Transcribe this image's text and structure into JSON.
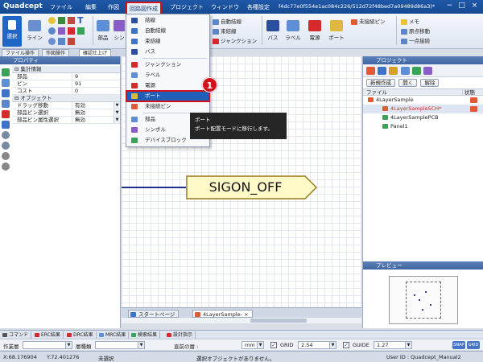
{
  "app": {
    "logo": "Quadcept",
    "menus": [
      "ファイル",
      "編集",
      "作図",
      "回路図作成",
      "プロジェクト",
      "ウィンドウ",
      "各種設定"
    ],
    "active_menu_index": 3,
    "file_path": "f4dc77e0f554e1ac084c226/512d72f48bed7a09489d86a3)*",
    "window_controls": [
      "−",
      "□",
      "×"
    ]
  },
  "ribbon": {
    "select_label": "選択",
    "line_label": "ライン",
    "parts_label": "部品",
    "sym_label": "シン",
    "right_small": [
      "自動結線",
      "束結線",
      "ジャンクション"
    ],
    "bus_label": "バス",
    "label_label": "ラベル",
    "power_label": "電源",
    "port_label": "ポート",
    "unconnected_pin": "未接続ピン",
    "memo": "メモ",
    "origin_move": "原点移動",
    "one_point": "一点接続"
  },
  "tabs_left": [
    "ファイル操作",
    "作図操作",
    "確認仕上げ"
  ],
  "property_panel": {
    "title": "プロパティ",
    "sections": [
      {
        "name": "集計情報",
        "rows": [
          {
            "key": "部品",
            "value": "9"
          },
          {
            "key": "ピン",
            "value": "91"
          },
          {
            "key": "コスト",
            "value": "0"
          }
        ]
      },
      {
        "name": "オブジェクト",
        "rows": [
          {
            "key": "ドラッグ移動",
            "value": "有効"
          },
          {
            "key": "部品ピン選択",
            "value": "無効"
          },
          {
            "key": "部品ピン属性選択",
            "value": "無効"
          }
        ]
      }
    ]
  },
  "dropdown": {
    "items": [
      {
        "label": "結線",
        "color": "#2c4ea0"
      },
      {
        "label": "自動結線",
        "color": "#3b73c6"
      },
      {
        "label": "束結線",
        "color": "#3b73c6"
      },
      {
        "label": "バス",
        "color": "#2c4ea0"
      },
      {
        "label": "ジャンクション",
        "color": "#d6292c"
      },
      {
        "label": "ラベル",
        "color": "#5e8fd6"
      },
      {
        "label": "電源",
        "color": "#d6292c"
      },
      {
        "label": "ポート",
        "color": "#e0b740"
      },
      {
        "label": "未接続ピン",
        "color": "#e05a38"
      },
      {
        "label": "部品",
        "color": "#5e8fd6"
      },
      {
        "label": "シンボル",
        "color": "#8a5cc7"
      },
      {
        "label": "デバイスブロック",
        "color": "#3aa35a"
      }
    ],
    "selected_index": 7
  },
  "callout": "1",
  "tooltip": {
    "title": "ポート",
    "text": "ポート配置モードに移行します。"
  },
  "canvas": {
    "port_text": "SIGON_OFF"
  },
  "doc_tabs": [
    "スタートページ",
    "4LayerSample-"
  ],
  "project_panel": {
    "title": "プロジェクト",
    "buttons": [
      "新規作成",
      "開く",
      "解除"
    ],
    "col_file": "ファイル",
    "col_status": "状態",
    "files": [
      {
        "name": "4LayerSample",
        "color": "#e05a38",
        "indent": 0,
        "status": true,
        "highlight": false
      },
      {
        "name": "4LayerSampleSCH*",
        "color": "#e05a38",
        "indent": 1,
        "status": true,
        "highlight": true
      },
      {
        "name": "4LayerSamplePCB",
        "color": "#3aa35a",
        "indent": 1,
        "status": false,
        "highlight": false
      },
      {
        "name": "Panel1",
        "color": "#3aa35a",
        "indent": 1,
        "status": false,
        "highlight": false
      }
    ]
  },
  "preview_panel": {
    "title": "プレビュー"
  },
  "result_tabs": [
    {
      "label": "コマンド",
      "color": "#555555"
    },
    {
      "label": "ERC結果",
      "color": "#d6292c"
    },
    {
      "label": "DRC結果",
      "color": "#d6292c"
    },
    {
      "label": "MRC結果",
      "color": "#5e8fd6"
    },
    {
      "label": "検索結果",
      "color": "#3aa35a"
    },
    {
      "label": "設計指示",
      "color": "#d6292c"
    }
  ],
  "options": {
    "layer_label": "作業層",
    "type_label": "層種類",
    "layer_value": "",
    "type_value": "",
    "direct_layer_label": "直前の層 :",
    "unit": "mm",
    "grid_label": "GRID",
    "grid_value": "2.54",
    "guide_label": "GUIDE",
    "guide_value": "1.27",
    "badges": [
      "SNAP",
      "GRID"
    ]
  },
  "status": {
    "x": "X:68.176904",
    "y": "Y:72.401276",
    "selection": "未選択",
    "message": "選択オブジェクトがありません。",
    "user": "User ID : Quadcept_Manual2"
  }
}
